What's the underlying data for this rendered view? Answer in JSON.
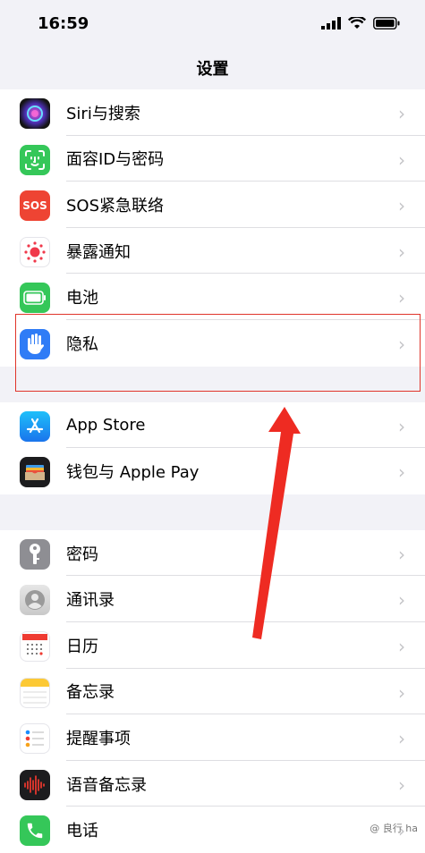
{
  "status": {
    "time": "16:59"
  },
  "nav": {
    "title": "设置"
  },
  "groups": [
    {
      "items": [
        {
          "label": "Siri与搜索"
        },
        {
          "label": "面容ID与密码"
        },
        {
          "label": "SOS紧急联络",
          "icon_text": "SOS"
        },
        {
          "label": "暴露通知"
        },
        {
          "label": "电池"
        },
        {
          "label": "隐私"
        }
      ]
    },
    {
      "items": [
        {
          "label": "App Store"
        },
        {
          "label": "钱包与 Apple Pay"
        }
      ]
    },
    {
      "items": [
        {
          "label": "密码"
        },
        {
          "label": "通讯录"
        },
        {
          "label": "日历"
        },
        {
          "label": "备忘录"
        },
        {
          "label": "提醒事项"
        },
        {
          "label": "语音备忘录"
        },
        {
          "label": "电话"
        }
      ]
    }
  ],
  "colors": {
    "annotation": "#e0342a",
    "chevron": "#c4c4c7",
    "background": "#f2f2f7"
  },
  "watermark": "@ 良行 ha"
}
